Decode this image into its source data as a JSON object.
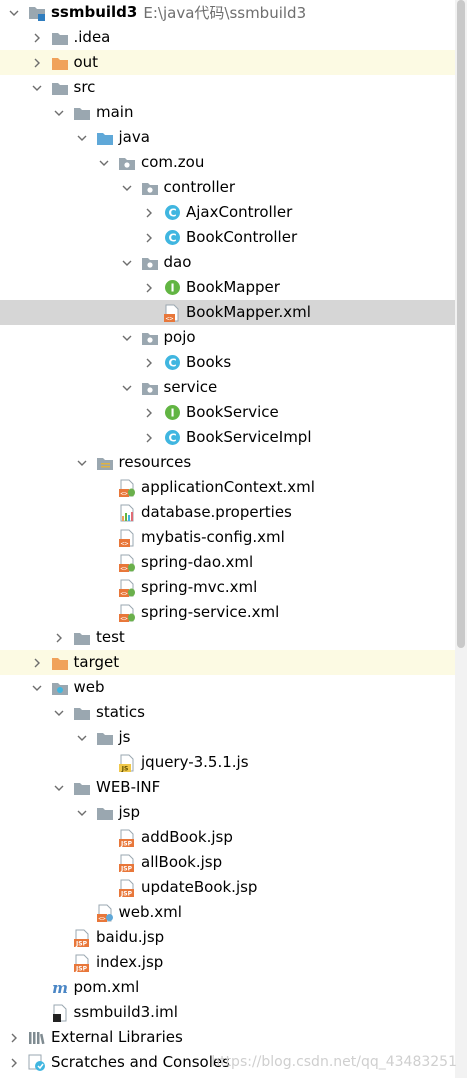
{
  "tree": [
    {
      "label": "ssmbuild3",
      "path": "E:\\java代码\\ssmbuild3",
      "level": 0,
      "arrow": "down",
      "icon": "project-module-icon",
      "bold": true
    },
    {
      "label": ".idea",
      "level": 1,
      "arrow": "right",
      "icon": "folder-grey-icon"
    },
    {
      "label": "out",
      "level": 1,
      "arrow": "right",
      "icon": "folder-orange-icon",
      "highlight": "yellow"
    },
    {
      "label": "src",
      "level": 1,
      "arrow": "down",
      "icon": "folder-grey-icon"
    },
    {
      "label": "main",
      "level": 2,
      "arrow": "down",
      "icon": "folder-grey-icon"
    },
    {
      "label": "java",
      "level": 3,
      "arrow": "down",
      "icon": "folder-blue-icon"
    },
    {
      "label": "com.zou",
      "level": 4,
      "arrow": "down",
      "icon": "package-icon"
    },
    {
      "label": "controller",
      "level": 5,
      "arrow": "down",
      "icon": "package-icon"
    },
    {
      "label": "AjaxController",
      "level": 6,
      "arrow": "right",
      "icon": "java-class-icon"
    },
    {
      "label": "BookController",
      "level": 6,
      "arrow": "right",
      "icon": "java-class-icon"
    },
    {
      "label": "dao",
      "level": 5,
      "arrow": "down",
      "icon": "package-icon"
    },
    {
      "label": "BookMapper",
      "level": 6,
      "arrow": "right",
      "icon": "java-interface-icon"
    },
    {
      "label": "BookMapper.xml",
      "level": 6,
      "arrow": "none",
      "icon": "xml-file-icon",
      "highlight": "selected"
    },
    {
      "label": "pojo",
      "level": 5,
      "arrow": "down",
      "icon": "package-icon"
    },
    {
      "label": "Books",
      "level": 6,
      "arrow": "right",
      "icon": "java-class-icon"
    },
    {
      "label": "service",
      "level": 5,
      "arrow": "down",
      "icon": "package-icon"
    },
    {
      "label": "BookService",
      "level": 6,
      "arrow": "right",
      "icon": "java-interface-icon"
    },
    {
      "label": "BookServiceImpl",
      "level": 6,
      "arrow": "right",
      "icon": "java-class-icon"
    },
    {
      "label": "resources",
      "level": 3,
      "arrow": "down",
      "icon": "resources-folder-icon"
    },
    {
      "label": "applicationContext.xml",
      "level": 4,
      "arrow": "none",
      "icon": "spring-xml-icon"
    },
    {
      "label": "database.properties",
      "level": 4,
      "arrow": "none",
      "icon": "properties-file-icon"
    },
    {
      "label": "mybatis-config.xml",
      "level": 4,
      "arrow": "none",
      "icon": "xml-file-icon"
    },
    {
      "label": "spring-dao.xml",
      "level": 4,
      "arrow": "none",
      "icon": "spring-xml-icon"
    },
    {
      "label": "spring-mvc.xml",
      "level": 4,
      "arrow": "none",
      "icon": "spring-xml-icon"
    },
    {
      "label": "spring-service.xml",
      "level": 4,
      "arrow": "none",
      "icon": "spring-xml-icon"
    },
    {
      "label": "test",
      "level": 2,
      "arrow": "right",
      "icon": "folder-grey-icon"
    },
    {
      "label": "target",
      "level": 1,
      "arrow": "right",
      "icon": "folder-orange-icon",
      "highlight": "yellow"
    },
    {
      "label": "web",
      "level": 1,
      "arrow": "down",
      "icon": "web-folder-icon"
    },
    {
      "label": "statics",
      "level": 2,
      "arrow": "down",
      "icon": "folder-grey-icon"
    },
    {
      "label": "js",
      "level": 3,
      "arrow": "down",
      "icon": "folder-grey-icon"
    },
    {
      "label": "jquery-3.5.1.js",
      "level": 4,
      "arrow": "none",
      "icon": "js-file-icon"
    },
    {
      "label": "WEB-INF",
      "level": 2,
      "arrow": "down",
      "icon": "folder-grey-icon"
    },
    {
      "label": "jsp",
      "level": 3,
      "arrow": "down",
      "icon": "folder-grey-icon"
    },
    {
      "label": "addBook.jsp",
      "level": 4,
      "arrow": "none",
      "icon": "jsp-file-icon"
    },
    {
      "label": "allBook.jsp",
      "level": 4,
      "arrow": "none",
      "icon": "jsp-file-icon"
    },
    {
      "label": "updateBook.jsp",
      "level": 4,
      "arrow": "none",
      "icon": "jsp-file-icon"
    },
    {
      "label": "web.xml",
      "level": 3,
      "arrow": "none",
      "icon": "web-xml-icon"
    },
    {
      "label": "baidu.jsp",
      "level": 2,
      "arrow": "none",
      "icon": "jsp-file-icon"
    },
    {
      "label": "index.jsp",
      "level": 2,
      "arrow": "none",
      "icon": "jsp-file-icon"
    },
    {
      "label": "pom.xml",
      "level": 1,
      "arrow": "none",
      "icon": "maven-icon"
    },
    {
      "label": "ssmbuild3.iml",
      "level": 1,
      "arrow": "none",
      "icon": "iml-file-icon"
    },
    {
      "label": "External Libraries",
      "level": 0,
      "arrow": "right",
      "icon": "libraries-icon"
    },
    {
      "label": "Scratches and Consoles",
      "level": 0,
      "arrow": "right",
      "icon": "scratches-icon"
    }
  ],
  "watermark": "https://blog.csdn.net/qq_43483251",
  "colors": {
    "folder_grey": "#9aa7b0",
    "folder_orange": "#f0a25b",
    "folder_blue": "#5fa8d8",
    "class_icon": "#40b6e0",
    "interface_icon": "#62b543",
    "selection": "#d6d6d6",
    "excluded_bg": "#fcfae3"
  }
}
